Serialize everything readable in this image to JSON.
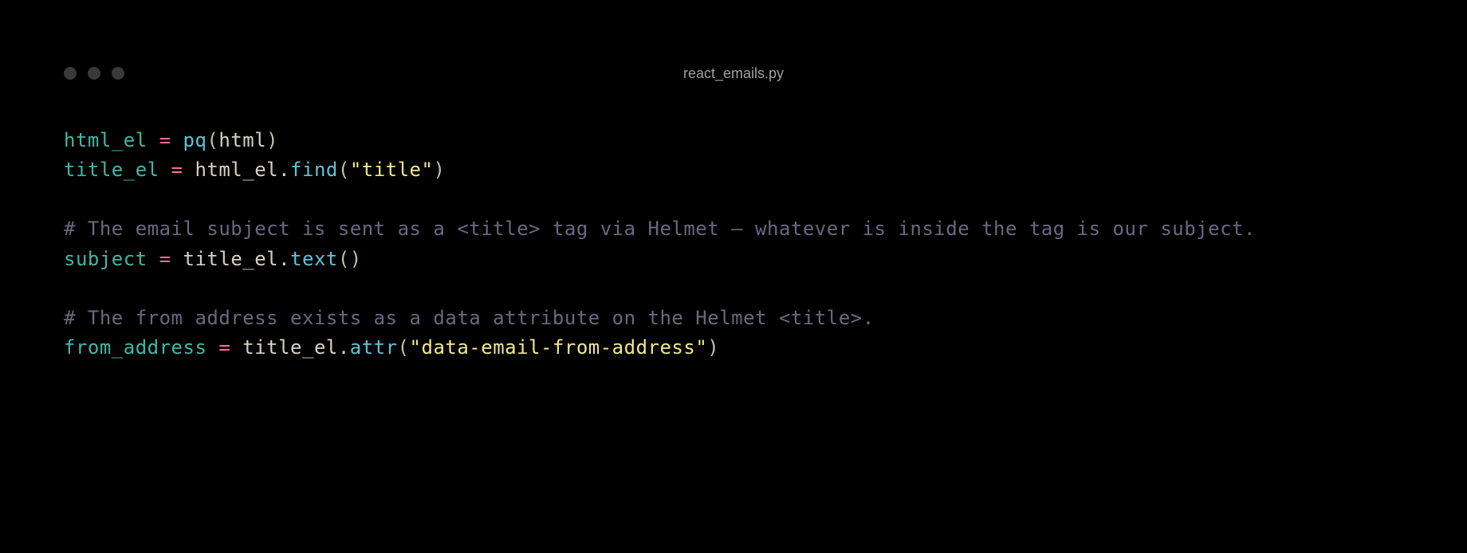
{
  "window": {
    "filename": "react_emails.py"
  },
  "code": {
    "line1": {
      "t1": "html_el",
      "t2": " ",
      "t3": "=",
      "t4": " ",
      "t5": "pq",
      "t6": "(",
      "t7": "html",
      "t8": ")"
    },
    "line2": {
      "t1": "title_el",
      "t2": " ",
      "t3": "=",
      "t4": " ",
      "t5": "html_el",
      "t6": ".",
      "t7": "find",
      "t8": "(",
      "t9": "\"title\"",
      "t10": ")"
    },
    "line3": {
      "t1": ""
    },
    "line4": {
      "t1": "# The email subject is sent as a <title> tag via Helmet – whatever is inside the tag is our subject."
    },
    "line5": {
      "t1": "subject",
      "t2": " ",
      "t3": "=",
      "t4": " ",
      "t5": "title_el",
      "t6": ".",
      "t7": "text",
      "t8": "()"
    },
    "line6": {
      "t1": ""
    },
    "line7": {
      "t1": "# The from address exists as a data attribute on the Helmet <title>."
    },
    "line8": {
      "t1": "from_address",
      "t2": " ",
      "t3": "=",
      "t4": " ",
      "t5": "title_el",
      "t6": ".",
      "t7": "attr",
      "t8": "(",
      "t9": "\"data-email-from-address\"",
      "t10": ")"
    }
  }
}
